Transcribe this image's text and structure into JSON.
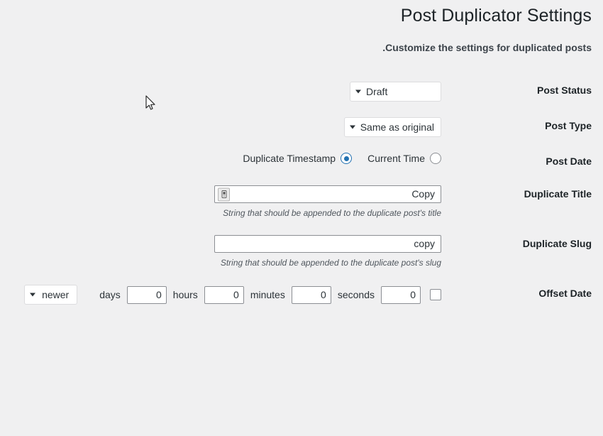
{
  "header": {
    "title": "Post Duplicator Settings",
    "subtitle": ".Customize the settings for duplicated posts"
  },
  "settings": {
    "post_status": {
      "label": "Post Status",
      "selected": "Draft"
    },
    "post_type": {
      "label": "Post Type",
      "selected": "Same as original"
    },
    "post_date": {
      "label": "Post Date",
      "options": [
        {
          "text": "Duplicate Timestamp",
          "checked": true
        },
        {
          "text": "Current Time",
          "checked": false
        }
      ]
    },
    "duplicate_title": {
      "label": "Duplicate Title",
      "value": "Copy",
      "description": "String that should be appended to the duplicate post's title",
      "icon": "password-manager-icon"
    },
    "duplicate_slug": {
      "label": "Duplicate Slug",
      "value": "copy",
      "description": "String that should be appended to the duplicate post's slug"
    },
    "offset_date": {
      "label": "Offset Date",
      "enabled": false,
      "direction": "newer",
      "units": [
        {
          "unit": "days",
          "value": "0"
        },
        {
          "unit": "hours",
          "value": "0"
        },
        {
          "unit": "minutes",
          "value": "0"
        },
        {
          "unit": "seconds",
          "value": "0"
        }
      ]
    }
  },
  "colors": {
    "background": "#f0f0f1",
    "accent": "#2271b1",
    "text": "#3c434a",
    "heading": "#1d2327"
  },
  "cursor": {
    "icon": "mouse-pointer-icon"
  }
}
